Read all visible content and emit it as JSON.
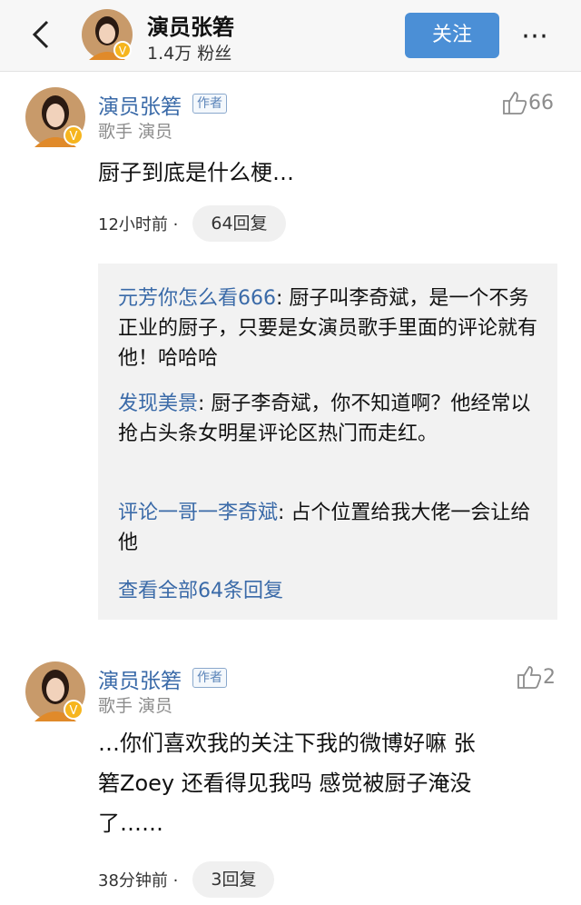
{
  "header": {
    "name": "演员张箬",
    "fans": "1.4万 粉丝",
    "follow_label": "关注",
    "colors": {
      "accent": "#4b8fd6",
      "link": "#3a6aa8"
    }
  },
  "comments": [
    {
      "name": "演员张箬",
      "badge": "作者",
      "desc": "歌手 演员",
      "likes": "66",
      "text": "厨子到底是什么梗…",
      "time": "12小时前 ·",
      "reply_count": "64回复",
      "replies": [
        {
          "name": "元芳你怎么看666",
          "text": ": 厨子叫李奇斌，是一个不务正业的厨子，只要是女演员歌手里面的评论就有他！哈哈哈"
        },
        {
          "name": "发现美景",
          "text": ": 厨子李奇斌，你不知道啊？他经常以抢占头条女明星评论区热门而走红。"
        },
        {
          "name": "评论一哥一李奇斌",
          "text": ": 占个位置给我大佬一会让给他"
        }
      ],
      "view_all": "查看全部64条回复"
    },
    {
      "name": "演员张箬",
      "badge": "作者",
      "desc": "歌手 演员",
      "likes": "2",
      "text_lines": [
        "…你们喜欢我的关注下我的微博好嘛 张",
        "箬Zoey 还看得见我吗 感觉被厨子淹没",
        "了……"
      ],
      "time": "38分钟前 ·",
      "reply_count": "3回复"
    }
  ]
}
